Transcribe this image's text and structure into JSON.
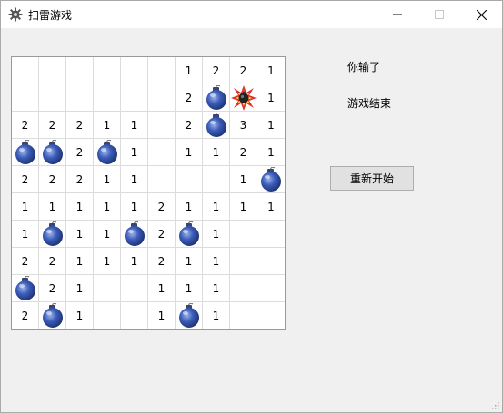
{
  "window": {
    "title": "扫雷游戏",
    "icon": "gear-icon",
    "controls": [
      "minimize-icon",
      "maximize-icon",
      "close-icon"
    ]
  },
  "board": {
    "rows": 10,
    "cols": 10,
    "cells": [
      [
        "",
        "",
        "",
        "",
        "",
        "",
        "1",
        "2",
        "2",
        "1"
      ],
      [
        "",
        "",
        "",
        "",
        "",
        "",
        "2",
        "M",
        "X",
        "1"
      ],
      [
        "2",
        "2",
        "2",
        "1",
        "1",
        "",
        "2",
        "M",
        "3",
        "1"
      ],
      [
        "M",
        "M",
        "2",
        "M",
        "1",
        "",
        "1",
        "1",
        "2",
        "1"
      ],
      [
        "2",
        "2",
        "2",
        "1",
        "1",
        "",
        "",
        "",
        "1",
        "M"
      ],
      [
        "1",
        "1",
        "1",
        "1",
        "1",
        "2",
        "1",
        "1",
        "1",
        "1"
      ],
      [
        "1",
        "M",
        "1",
        "1",
        "M",
        "2",
        "M",
        "1",
        "",
        ""
      ],
      [
        "2",
        "2",
        "1",
        "1",
        "1",
        "2",
        "1",
        "1",
        "",
        ""
      ],
      [
        "M",
        "2",
        "1",
        "",
        "",
        "1",
        "1",
        "1",
        "",
        ""
      ],
      [
        "2",
        "M",
        "1",
        "",
        "",
        "1",
        "M",
        "1",
        "",
        ""
      ]
    ],
    "legend": {
      "M": "mine-icon",
      "X": "exploded-mine-icon"
    }
  },
  "status": {
    "lose_text": "你输了",
    "game_over_text": "游戏结束"
  },
  "controls": {
    "restart_label": "重新开始"
  },
  "colors": {
    "mine": "#3a5cb8",
    "explosion": "#e23030"
  }
}
